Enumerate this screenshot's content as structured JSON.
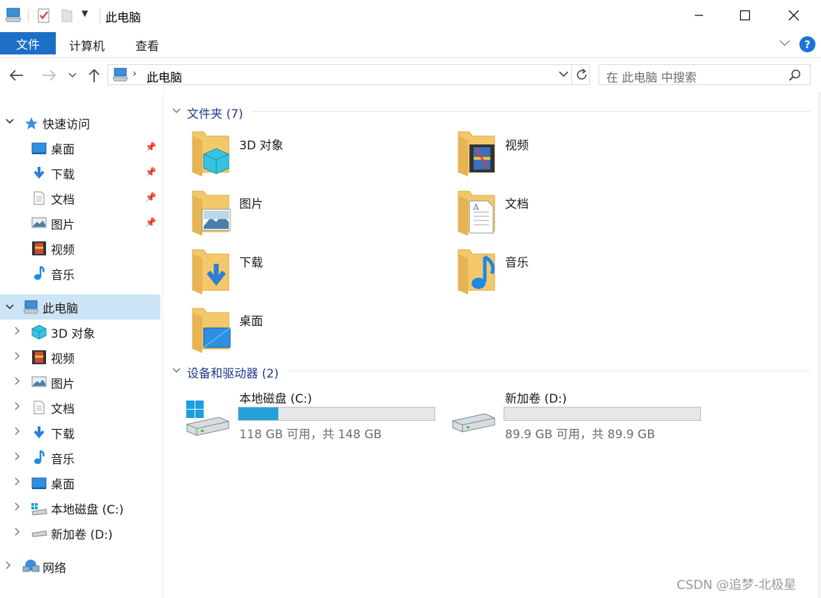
{
  "window": {
    "title": "此电脑",
    "tabs": {
      "file": "文件",
      "computer": "计算机",
      "view": "查看"
    },
    "help": "?"
  },
  "addressbar": {
    "location": "此电脑",
    "search_placeholder": "在 此电脑 中搜索"
  },
  "sidebar": {
    "quick_access": "快速访问",
    "quick_items": [
      "桌面",
      "下载",
      "文档",
      "图片",
      "视频",
      "音乐"
    ],
    "this_pc": "此电脑",
    "pc_items": [
      "3D 对象",
      "视频",
      "图片",
      "文档",
      "下载",
      "音乐",
      "桌面",
      "本地磁盘 (C:)",
      "新加卷 (D:)"
    ],
    "network": "网络"
  },
  "content": {
    "folders_header": "文件夹 (7)",
    "folders": [
      "3D 对象",
      "视频",
      "图片",
      "文档",
      "下载",
      "音乐",
      "桌面"
    ],
    "drives_header": "设备和驱动器 (2)",
    "drives": [
      {
        "name": "本地磁盘 (C:)",
        "free_text": "118 GB 可用，共 148 GB",
        "used_fraction": 0.203
      },
      {
        "name": "新加卷 (D:)",
        "free_text": "89.9 GB 可用，共 89.9 GB",
        "used_fraction": 0.0
      }
    ]
  },
  "watermark": "CSDN @追梦-北极星",
  "colors": {
    "accent": "#1c6fc6",
    "selection": "#cce4f7",
    "drive_bar": "#26a0da",
    "folder": "#f3c86b"
  }
}
